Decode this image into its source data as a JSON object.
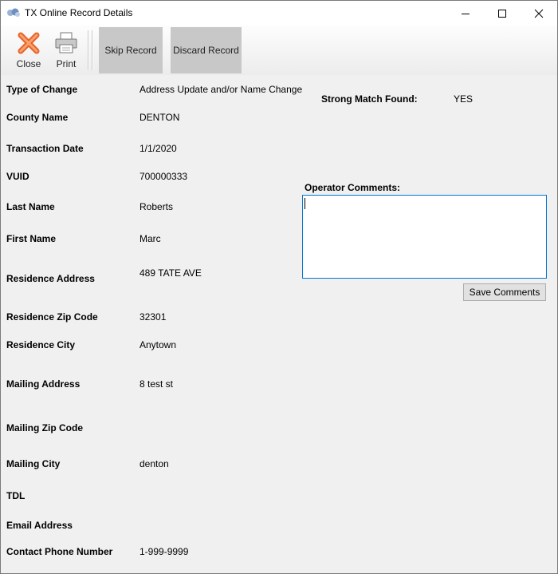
{
  "window": {
    "title": "TX Online Record Details",
    "icons": {
      "app": "app-icon",
      "minimize": "minimize-icon",
      "maximize": "maximize-icon",
      "close": "close-window-icon"
    }
  },
  "toolbar": {
    "close_label": "Close",
    "print_label": "Print",
    "skip_label": "Skip Record",
    "discard_label": "Discard Record",
    "icons": {
      "close": "close-x-icon",
      "print": "printer-icon"
    },
    "colors": {
      "close_icon": "#e8632b",
      "skip_bg": "#c8c8c8"
    }
  },
  "record": {
    "type_of_change": {
      "label": "Type of Change",
      "value": "Address Update and/or Name Change"
    },
    "county_name": {
      "label": "County Name",
      "value": "DENTON"
    },
    "transaction_date": {
      "label": "Transaction Date",
      "value": "1/1/2020"
    },
    "vuid": {
      "label": "VUID",
      "value": "700000333"
    },
    "last_name": {
      "label": "Last Name",
      "value": "Roberts"
    },
    "first_name": {
      "label": "First Name",
      "value": "Marc"
    },
    "residence_address": {
      "label": "Residence Address",
      "value": "489 TATE AVE"
    },
    "residence_zip": {
      "label": "Residence Zip Code",
      "value": "32301"
    },
    "residence_city": {
      "label": "Residence City",
      "value": "Anytown"
    },
    "mailing_address": {
      "label": "Mailing Address",
      "value": "8 test st"
    },
    "mailing_zip": {
      "label": "Mailing Zip Code",
      "value": ""
    },
    "mailing_city": {
      "label": "Mailing City",
      "value": "denton"
    },
    "tdl": {
      "label": "TDL",
      "value": ""
    },
    "email": {
      "label": "Email Address",
      "value": ""
    },
    "phone": {
      "label": "Contact Phone Number",
      "value": "1-999-9999"
    }
  },
  "match": {
    "label": "Strong Match Found:",
    "value": "YES"
  },
  "comments": {
    "label": "Operator Comments:",
    "value": "",
    "save_label": "Save Comments",
    "border_color": "#0078d7"
  }
}
